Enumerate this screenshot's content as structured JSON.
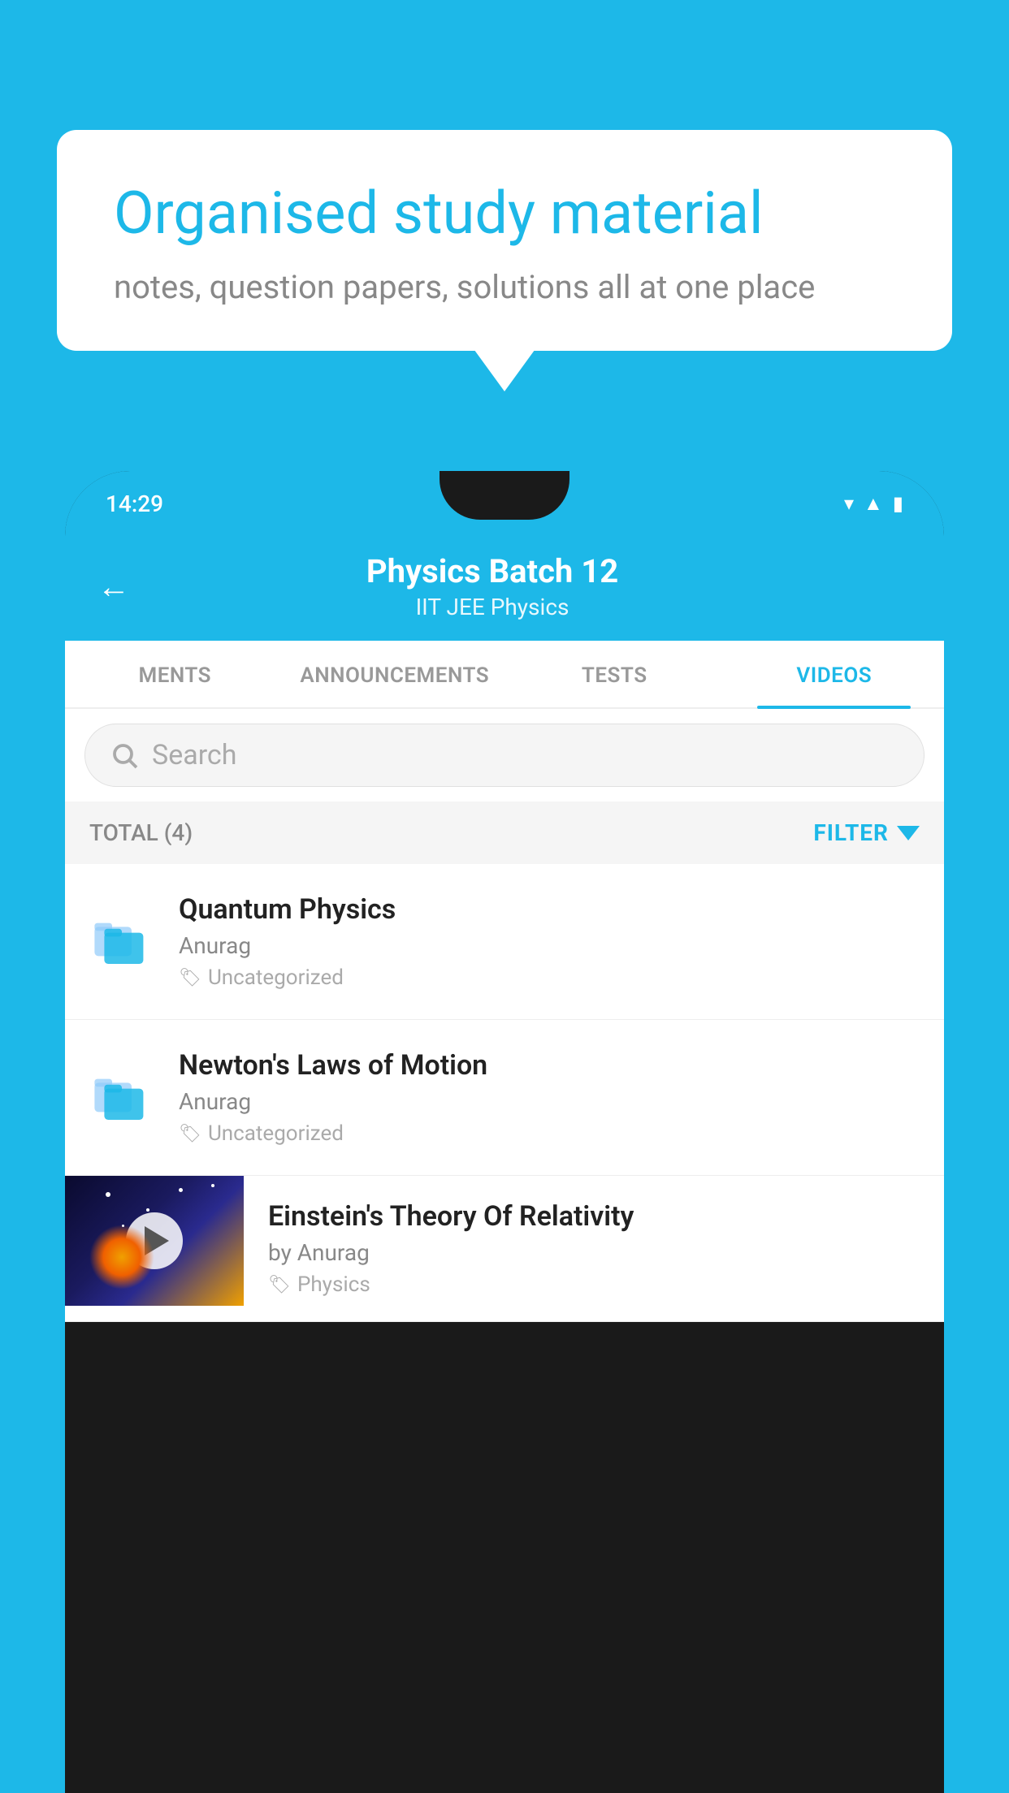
{
  "background_color": "#1DB8E8",
  "speech_bubble": {
    "title": "Organised study material",
    "subtitle": "notes, question papers, solutions all at one place"
  },
  "phone": {
    "status_bar": {
      "time": "14:29"
    },
    "app_bar": {
      "title": "Physics Batch 12",
      "subtitle": "IIT JEE   Physics",
      "back_label": "←"
    },
    "tabs": [
      {
        "label": "MENTS",
        "active": false
      },
      {
        "label": "ANNOUNCEMENTS",
        "active": false
      },
      {
        "label": "TESTS",
        "active": false
      },
      {
        "label": "VIDEOS",
        "active": true
      }
    ],
    "search": {
      "placeholder": "Search"
    },
    "filter_row": {
      "total_label": "TOTAL (4)",
      "filter_label": "FILTER"
    },
    "video_items": [
      {
        "id": 1,
        "title": "Quantum Physics",
        "author": "Anurag",
        "tag": "Uncategorized",
        "type": "folder"
      },
      {
        "id": 2,
        "title": "Newton's Laws of Motion",
        "author": "Anurag",
        "tag": "Uncategorized",
        "type": "folder"
      },
      {
        "id": 3,
        "title": "Einstein's Theory Of Relativity",
        "author": "by Anurag",
        "tag": "Physics",
        "type": "video"
      }
    ]
  }
}
